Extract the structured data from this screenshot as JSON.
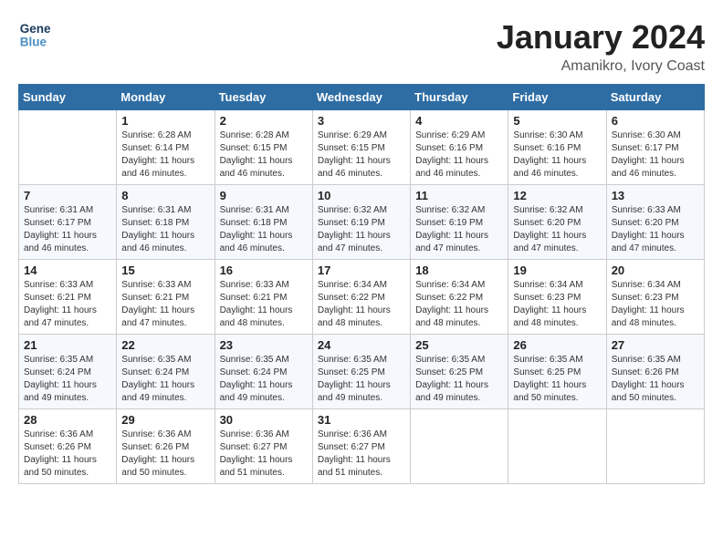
{
  "header": {
    "logo_line1": "General",
    "logo_line2": "Blue",
    "month": "January 2024",
    "location": "Amanikro, Ivory Coast"
  },
  "weekdays": [
    "Sunday",
    "Monday",
    "Tuesday",
    "Wednesday",
    "Thursday",
    "Friday",
    "Saturday"
  ],
  "weeks": [
    [
      {
        "day": "",
        "info": ""
      },
      {
        "day": "1",
        "info": "Sunrise: 6:28 AM\nSunset: 6:14 PM\nDaylight: 11 hours\nand 46 minutes."
      },
      {
        "day": "2",
        "info": "Sunrise: 6:28 AM\nSunset: 6:15 PM\nDaylight: 11 hours\nand 46 minutes."
      },
      {
        "day": "3",
        "info": "Sunrise: 6:29 AM\nSunset: 6:15 PM\nDaylight: 11 hours\nand 46 minutes."
      },
      {
        "day": "4",
        "info": "Sunrise: 6:29 AM\nSunset: 6:16 PM\nDaylight: 11 hours\nand 46 minutes."
      },
      {
        "day": "5",
        "info": "Sunrise: 6:30 AM\nSunset: 6:16 PM\nDaylight: 11 hours\nand 46 minutes."
      },
      {
        "day": "6",
        "info": "Sunrise: 6:30 AM\nSunset: 6:17 PM\nDaylight: 11 hours\nand 46 minutes."
      }
    ],
    [
      {
        "day": "7",
        "info": "Sunrise: 6:31 AM\nSunset: 6:17 PM\nDaylight: 11 hours\nand 46 minutes."
      },
      {
        "day": "8",
        "info": "Sunrise: 6:31 AM\nSunset: 6:18 PM\nDaylight: 11 hours\nand 46 minutes."
      },
      {
        "day": "9",
        "info": "Sunrise: 6:31 AM\nSunset: 6:18 PM\nDaylight: 11 hours\nand 46 minutes."
      },
      {
        "day": "10",
        "info": "Sunrise: 6:32 AM\nSunset: 6:19 PM\nDaylight: 11 hours\nand 47 minutes."
      },
      {
        "day": "11",
        "info": "Sunrise: 6:32 AM\nSunset: 6:19 PM\nDaylight: 11 hours\nand 47 minutes."
      },
      {
        "day": "12",
        "info": "Sunrise: 6:32 AM\nSunset: 6:20 PM\nDaylight: 11 hours\nand 47 minutes."
      },
      {
        "day": "13",
        "info": "Sunrise: 6:33 AM\nSunset: 6:20 PM\nDaylight: 11 hours\nand 47 minutes."
      }
    ],
    [
      {
        "day": "14",
        "info": "Sunrise: 6:33 AM\nSunset: 6:21 PM\nDaylight: 11 hours\nand 47 minutes."
      },
      {
        "day": "15",
        "info": "Sunrise: 6:33 AM\nSunset: 6:21 PM\nDaylight: 11 hours\nand 47 minutes."
      },
      {
        "day": "16",
        "info": "Sunrise: 6:33 AM\nSunset: 6:21 PM\nDaylight: 11 hours\nand 48 minutes."
      },
      {
        "day": "17",
        "info": "Sunrise: 6:34 AM\nSunset: 6:22 PM\nDaylight: 11 hours\nand 48 minutes."
      },
      {
        "day": "18",
        "info": "Sunrise: 6:34 AM\nSunset: 6:22 PM\nDaylight: 11 hours\nand 48 minutes."
      },
      {
        "day": "19",
        "info": "Sunrise: 6:34 AM\nSunset: 6:23 PM\nDaylight: 11 hours\nand 48 minutes."
      },
      {
        "day": "20",
        "info": "Sunrise: 6:34 AM\nSunset: 6:23 PM\nDaylight: 11 hours\nand 48 minutes."
      }
    ],
    [
      {
        "day": "21",
        "info": "Sunrise: 6:35 AM\nSunset: 6:24 PM\nDaylight: 11 hours\nand 49 minutes."
      },
      {
        "day": "22",
        "info": "Sunrise: 6:35 AM\nSunset: 6:24 PM\nDaylight: 11 hours\nand 49 minutes."
      },
      {
        "day": "23",
        "info": "Sunrise: 6:35 AM\nSunset: 6:24 PM\nDaylight: 11 hours\nand 49 minutes."
      },
      {
        "day": "24",
        "info": "Sunrise: 6:35 AM\nSunset: 6:25 PM\nDaylight: 11 hours\nand 49 minutes."
      },
      {
        "day": "25",
        "info": "Sunrise: 6:35 AM\nSunset: 6:25 PM\nDaylight: 11 hours\nand 49 minutes."
      },
      {
        "day": "26",
        "info": "Sunrise: 6:35 AM\nSunset: 6:25 PM\nDaylight: 11 hours\nand 50 minutes."
      },
      {
        "day": "27",
        "info": "Sunrise: 6:35 AM\nSunset: 6:26 PM\nDaylight: 11 hours\nand 50 minutes."
      }
    ],
    [
      {
        "day": "28",
        "info": "Sunrise: 6:36 AM\nSunset: 6:26 PM\nDaylight: 11 hours\nand 50 minutes."
      },
      {
        "day": "29",
        "info": "Sunrise: 6:36 AM\nSunset: 6:26 PM\nDaylight: 11 hours\nand 50 minutes."
      },
      {
        "day": "30",
        "info": "Sunrise: 6:36 AM\nSunset: 6:27 PM\nDaylight: 11 hours\nand 51 minutes."
      },
      {
        "day": "31",
        "info": "Sunrise: 6:36 AM\nSunset: 6:27 PM\nDaylight: 11 hours\nand 51 minutes."
      },
      {
        "day": "",
        "info": ""
      },
      {
        "day": "",
        "info": ""
      },
      {
        "day": "",
        "info": ""
      }
    ]
  ]
}
